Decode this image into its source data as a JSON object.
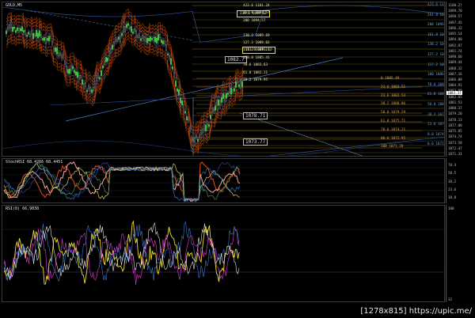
{
  "symbol_label": "GOLD,M5",
  "stoch_label": "StochRSI 68.4266 68.4451",
  "rsi_label": "RSI(8) 66.9838",
  "watermark": "[1278x815] https://upic.me/",
  "main_scale": [
    "1100.2?",
    "1099.70",
    "1098.57",
    "1097.45",
    "1096.32",
    "1095.14",
    "1094.00",
    "1092.87",
    "1091.74",
    "1090.60",
    "1089.44",
    "1088.32",
    "1087.16",
    "1086.08",
    "1084.91",
    "1083.80",
    "1082.65",
    "1081.53",
    "1080.37",
    "1079.20",
    "1078.13",
    "1077.00",
    "1075.85",
    "1074.74",
    "1073.58",
    "1072.47",
    "1071.31"
  ],
  "current_price_flag": "1083.37",
  "stoch_scale": [
    "78.4",
    "58.5",
    "38.2",
    "23.6",
    "18.8"
  ],
  "rsi_scale": [
    "100",
    "32"
  ],
  "fib_left": [
    {
      "text": "423.6 1101.24",
      "row": 0
    },
    {
      "text": "261.8 1094.57",
      "row": 1
    },
    {
      "text": "200 1094.57",
      "row": 2
    },
    {
      "text": "161.8 1091.12",
      "row": 3
    },
    {
      "text": "138.2 1089.69",
      "row": 4
    },
    {
      "text": "127.2 1089.03",
      "row": 5
    },
    {
      "text": "117.2 1087.11",
      "row": 6
    },
    {
      "text": "100.0 1085.41",
      "row": 7
    },
    {
      "text": "78.6 1083.63",
      "row": 8
    },
    {
      "text": "61.8 1082.11",
      "row": 9
    },
    {
      "text": "38.2 1079.95",
      "row": 10
    }
  ],
  "fib_right": [
    {
      "text": "0 1085.49",
      "row": 0
    },
    {
      "text": "23.6 1083.51",
      "row": 1
    },
    {
      "text": "23.6 1082.54",
      "row": 2
    },
    {
      "text": "38.2 1080.06",
      "row": 3
    },
    {
      "text": "50.0 1079.29",
      "row": 4
    },
    {
      "text": "61.8 1075.71",
      "row": 5
    },
    {
      "text": "78.6 1074.21",
      "row": 6
    },
    {
      "text": "88.6 1072.95",
      "row": 7
    },
    {
      "text": "100 1071.28",
      "row": 8
    }
  ],
  "fib_far": [
    {
      "text": "423.6 1100.23",
      "row": 0
    },
    {
      "text": "261.8 1098.53",
      "row": 1
    },
    {
      "text": "200 1096.40",
      "row": 2
    },
    {
      "text": "161.8 1093.04",
      "row": 3
    },
    {
      "text": "138.2 1092.11",
      "row": 4
    },
    {
      "text": "127.2 1091.17",
      "row": 5
    },
    {
      "text": "117.2 1087.43",
      "row": 6
    },
    {
      "text": "100 1086.65",
      "row": 7
    },
    {
      "text": "78.6 1084.50",
      "row": 8
    },
    {
      "text": "61.8 1082.33",
      "row": 9
    },
    {
      "text": "50.0 1080.51",
      "row": 10
    },
    {
      "text": "38.2 1079.52",
      "row": 11
    },
    {
      "text": "23.6 1077.46",
      "row": 12
    },
    {
      "text": "0.0 1074.28",
      "row": 13
    },
    {
      "text": "0.0 1071.54",
      "row": 14
    }
  ],
  "box_high": "238.2 1099.62",
  "box_mid": "161.8 1091.12",
  "tag_upper": "1082.7",
  "tag_mid": "1078.71",
  "tag_low": "1073.77"
}
